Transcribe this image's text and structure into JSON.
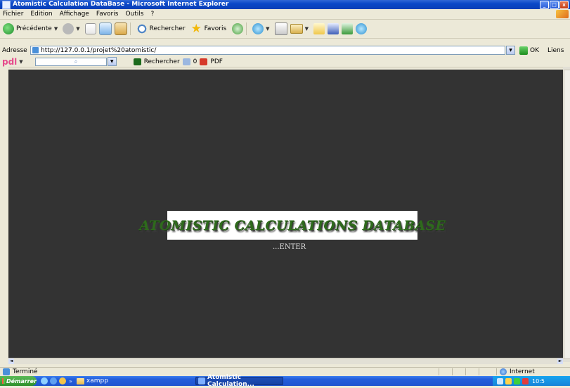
{
  "window": {
    "title": "Atomistic Calculation DataBase - Microsoft Internet Explorer",
    "buttons": [
      "_",
      "□",
      "x"
    ]
  },
  "menu": [
    "Fichier",
    "Edition",
    "Affichage",
    "Favoris",
    "Outils",
    "?"
  ],
  "toolbar": {
    "back_label": "Précédente",
    "search_label": "Rechercher",
    "favorites_label": "Favoris"
  },
  "address": {
    "label": "Adresse",
    "url": "http://127.0.0.1/projet%20atomistic/",
    "go_label": "OK",
    "links_label": "Liens"
  },
  "pdl": {
    "brand": "pdl",
    "search_label": "Rechercher",
    "counter": "0",
    "pdf_label": "PDF"
  },
  "page": {
    "logo_text": "ATOMISTIC CALCULATIONS DATABASE",
    "enter_link": "ENTER"
  },
  "status": {
    "text": "Terminé",
    "zone": "Internet"
  },
  "taskbar": {
    "start": "Démarrer",
    "folder": "xampp",
    "task": "Atomistic Calculation...",
    "clock": "10:5"
  }
}
